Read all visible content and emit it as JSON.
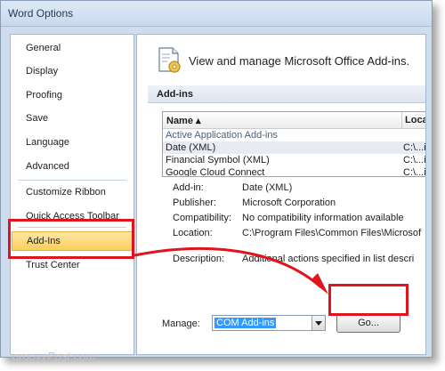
{
  "window": {
    "title": "Word Options"
  },
  "sidebar": {
    "items": [
      {
        "label": "General"
      },
      {
        "label": "Display"
      },
      {
        "label": "Proofing"
      },
      {
        "label": "Save"
      },
      {
        "label": "Language"
      },
      {
        "label": "Advanced"
      },
      {
        "label": "Customize Ribbon"
      },
      {
        "label": "Quick Access Toolbar"
      },
      {
        "label": "Add-Ins",
        "selected": true
      },
      {
        "label": "Trust Center"
      }
    ]
  },
  "main": {
    "heading": "View and manage Microsoft Office Add-ins.",
    "section_title": "Add-ins",
    "table": {
      "columns": [
        "Name ▴",
        "Locati"
      ],
      "rows": [
        {
          "name": "Active Application Add-ins",
          "location": "",
          "group": true
        },
        {
          "name": "Date (XML)",
          "location": "C:\\...ic"
        },
        {
          "name": "Financial Symbol (XML)",
          "location": "C:\\...ic"
        },
        {
          "name": "Google Cloud Connect",
          "location": "C:\\...ic"
        }
      ]
    },
    "details": [
      {
        "key": "Add-in:",
        "value": "Date (XML)"
      },
      {
        "key": "Publisher:",
        "value": "Microsoft Corporation"
      },
      {
        "key": "Compatibility:",
        "value": "No compatibility information available"
      },
      {
        "key": "Location:",
        "value": "C:\\Program Files\\Common Files\\Microsof"
      },
      {
        "key": "Description:",
        "value": "Additional actions specified in list descri"
      }
    ],
    "manage": {
      "label": "Manage:",
      "selected": "COM Add-ins",
      "go_label": "Go..."
    }
  },
  "watermark": "groovyPost.com",
  "colors": {
    "annotation_red": "#e0141c",
    "selection": "#fbcf5c",
    "combo_highlight": "#3399ff"
  }
}
